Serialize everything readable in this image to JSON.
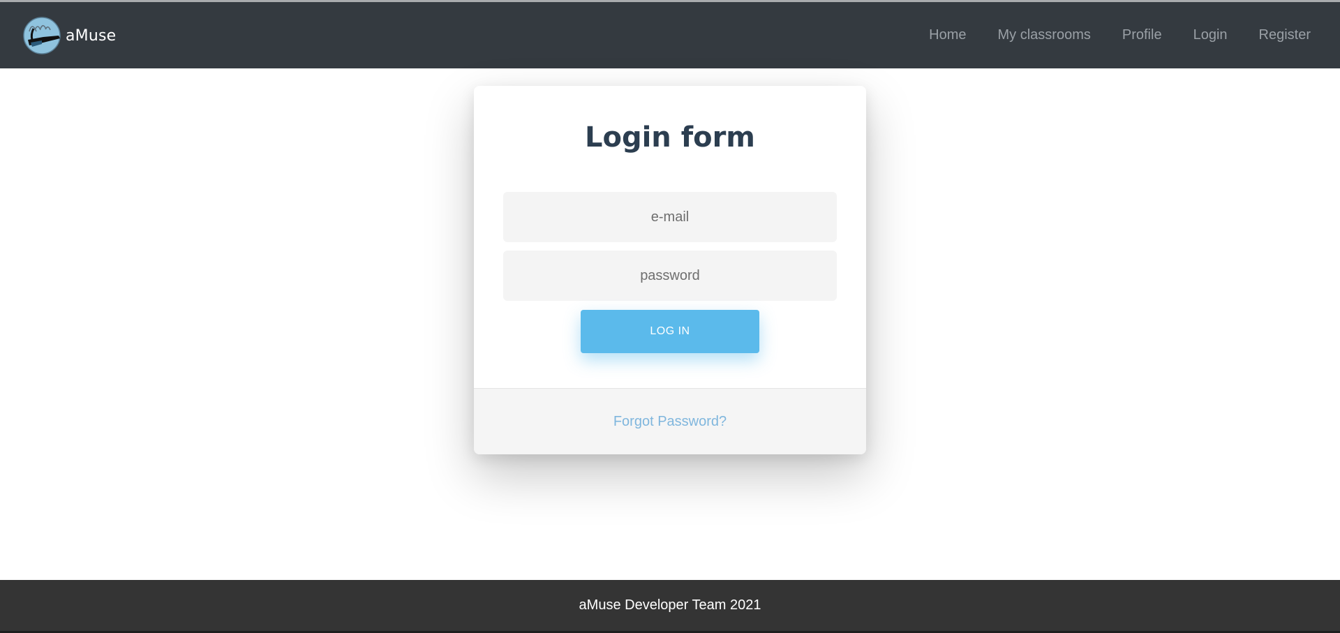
{
  "header": {
    "brand": "aMuse",
    "nav": [
      {
        "label": "Home"
      },
      {
        "label": "My classrooms"
      },
      {
        "label": "Profile"
      },
      {
        "label": "Login"
      },
      {
        "label": "Register"
      }
    ],
    "logo_icon": "amuse-logo-icon"
  },
  "login": {
    "title": "Login form",
    "email_placeholder": "e-mail",
    "password_placeholder": "password",
    "submit_label": "LOG IN",
    "forgot_label": "Forgot Password?"
  },
  "footer": {
    "text": "aMuse Developer Team 2021"
  },
  "colors": {
    "navbar": "#343a40",
    "accent": "#5bbaeb",
    "title": "#2c3e50",
    "footer": "#343434",
    "link": "#7fb6dd"
  }
}
